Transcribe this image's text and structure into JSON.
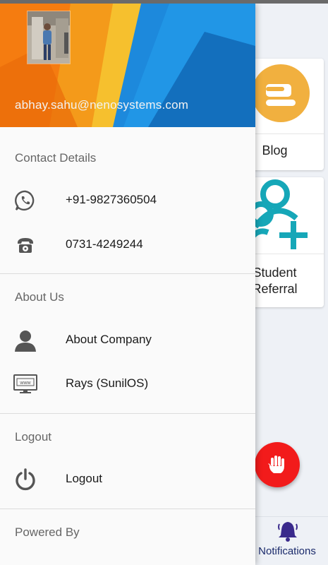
{
  "drawer": {
    "email": "abhay.sahu@nenosystems.com",
    "sections": {
      "contact": "Contact Details",
      "about": "About Us",
      "logout": "Logout",
      "powered": "Powered By"
    },
    "items": {
      "whatsapp": "+91-9827360504",
      "phone": "0731-4249244",
      "about_company": "About Company",
      "rays": "Rays (SunilOS)",
      "logout": "Logout"
    }
  },
  "background": {
    "tiles": {
      "blog": "Blog",
      "referral_line1": "Student",
      "referral_line2": "Referral"
    },
    "bottom_nav": {
      "notifications": "Notifications"
    }
  },
  "colors": {
    "fab": "#f21b1b",
    "blog_icon": "#f1b03f",
    "referral_icon": "#16a7b8"
  }
}
